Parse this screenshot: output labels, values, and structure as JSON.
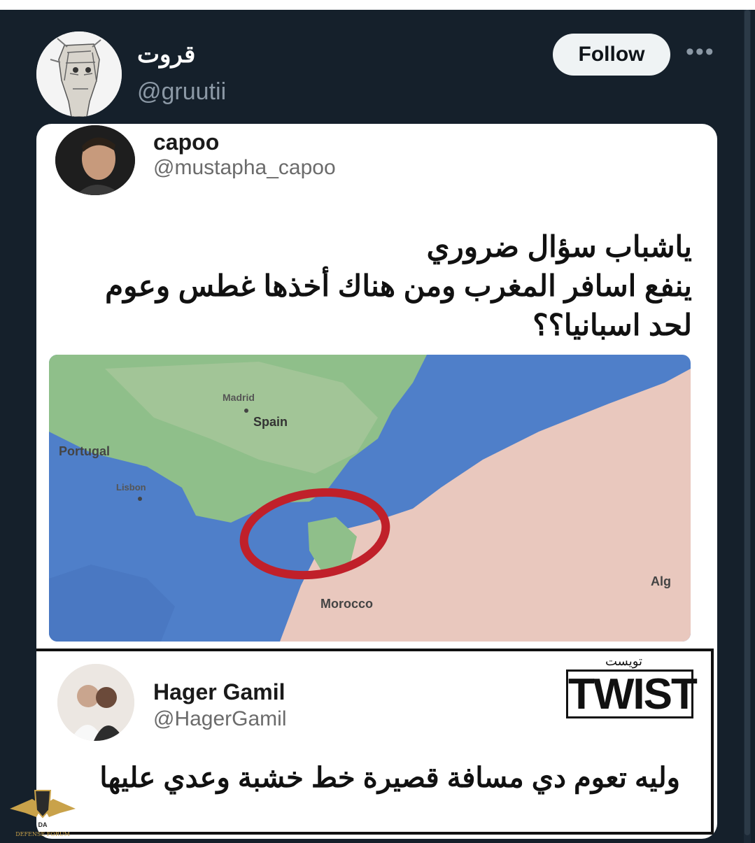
{
  "tweet": {
    "author": {
      "display_name": "قروت",
      "handle": "@gruutii"
    },
    "follow_label": "Follow",
    "more_icon": "more-horizontal-icon"
  },
  "quoted": {
    "author": {
      "display_name": "capoo",
      "handle": "@mustapha_capoo"
    },
    "text_lines": [
      "ياشباب سؤال ضروري",
      "ينفع اسافر المغرب ومن هناك أخذها غطس وعوم",
      "لحد اسبانيا؟؟"
    ],
    "map": {
      "labels": {
        "madrid": "Madrid",
        "spain": "Spain",
        "portugal": "Portugal",
        "lisbon": "Lisbon",
        "morocco": "Morocco",
        "algeria": "Alg"
      },
      "highlight_color": "#c0202a"
    }
  },
  "reply": {
    "author": {
      "display_name": "Hager Gamil",
      "handle": "@HagerGamil"
    },
    "brand": {
      "arabic": "تويست",
      "latin": "TWIST"
    },
    "text": "وليه تعوم دي مسافة قصيرة خط خشبة وعدي عليها"
  },
  "watermark": {
    "text": "DEFENSE FORUM",
    "logo": "eagle-shield-logo"
  }
}
